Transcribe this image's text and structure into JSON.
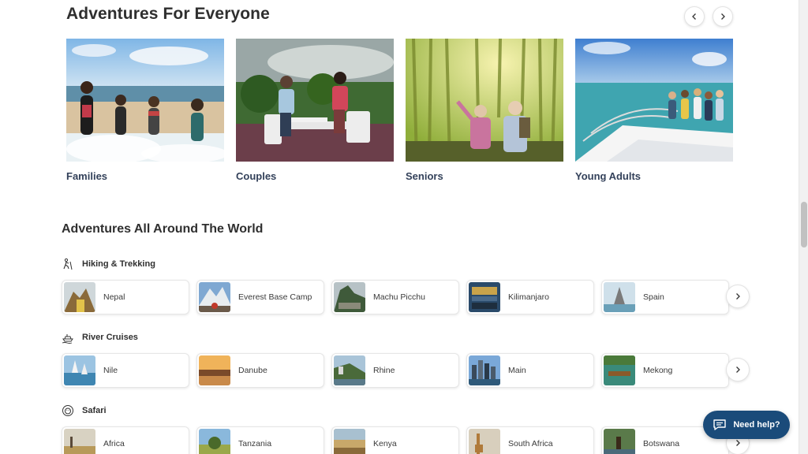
{
  "adventures_for_everyone": {
    "title": "Adventures For Everyone",
    "cards": [
      {
        "label": "Families"
      },
      {
        "label": "Couples"
      },
      {
        "label": "Seniors"
      },
      {
        "label": "Young Adults"
      }
    ]
  },
  "around_the_world": {
    "title": "Adventures All Around The World",
    "categories": [
      {
        "name": "Hiking & Trekking",
        "icon": "hiking-icon",
        "destinations": [
          "Nepal",
          "Everest Base Camp",
          "Machu Picchu",
          "Kilimanjaro",
          "Spain"
        ]
      },
      {
        "name": "River Cruises",
        "icon": "ship-icon",
        "destinations": [
          "Nile",
          "Danube",
          "Rhine",
          "Main",
          "Mekong"
        ]
      },
      {
        "name": "Safari",
        "icon": "lion-icon",
        "destinations": [
          "Africa",
          "Tanzania",
          "Kenya",
          "South Africa",
          "Botswana"
        ]
      }
    ]
  },
  "help_button": {
    "label": "Need help?",
    "color": "#1a4b7a"
  }
}
